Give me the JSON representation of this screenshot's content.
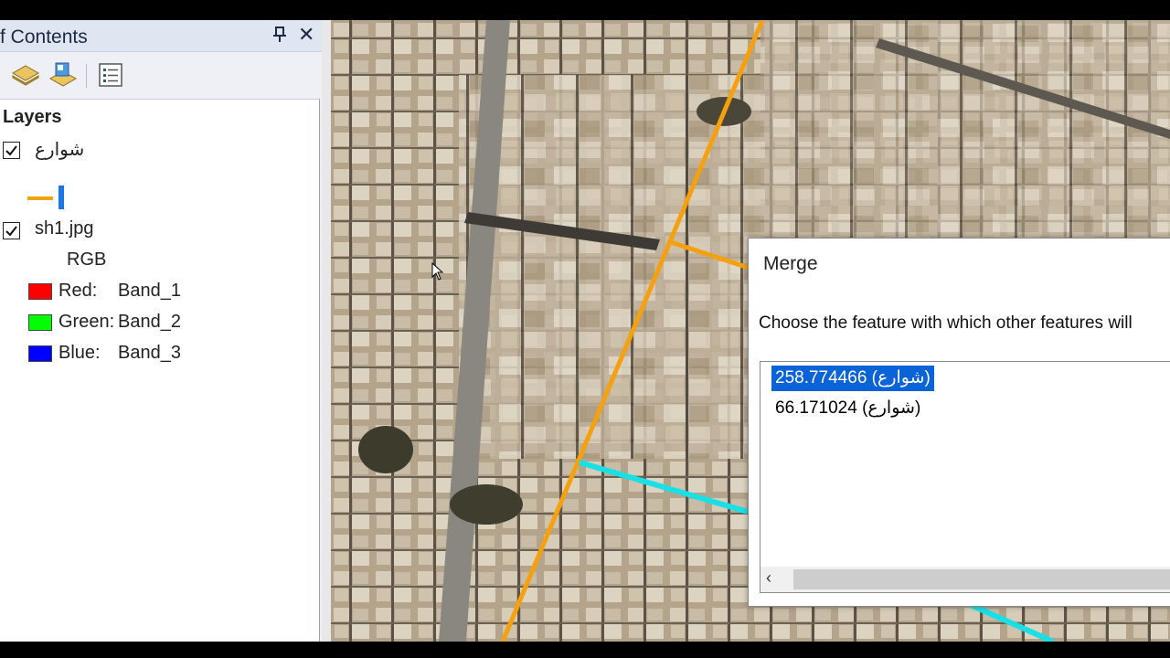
{
  "toc": {
    "title": "f Contents",
    "layers_heading": "Layers",
    "layers": [
      {
        "name": "شوارع",
        "checked": true,
        "symbol": "line",
        "symbol_color": "#f0a30a"
      },
      {
        "name": "sh1.jpg",
        "checked": true,
        "renderer": "RGB",
        "bands": [
          {
            "label": "Red:",
            "band": "Band_1",
            "color": "#ff0000"
          },
          {
            "label": "Green:",
            "band": "Band_2",
            "color": "#00ff00"
          },
          {
            "label": "Blue:",
            "band": "Band_3",
            "color": "#0000ff"
          }
        ]
      }
    ],
    "toolbar_icons": [
      "list-by-drawing-order-icon",
      "list-by-source-icon",
      "options-icon"
    ]
  },
  "dialog": {
    "title": "Merge",
    "prompt": "Choose the feature with which other features will",
    "items": [
      {
        "text": "258.774466 (شوارع)",
        "selected": true
      },
      {
        "text": "66.171024 (شوارع)",
        "selected": false
      }
    ]
  },
  "colors": {
    "road_orange": "#f5a00f",
    "road_cyan": "#19e0e6",
    "selection_blue": "#0a64d8"
  }
}
